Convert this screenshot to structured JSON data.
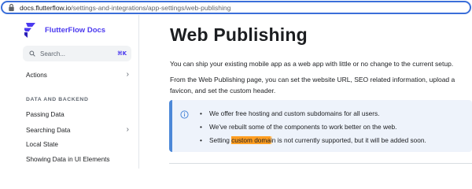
{
  "browser": {
    "url_host": "docs.flutterflow.io",
    "url_path": "/settings-and-integrations/app-settings/web-publishing"
  },
  "sidebar": {
    "brand": "FlutterFlow Docs",
    "search_placeholder": "Search...",
    "search_shortcut": "⌘K",
    "items": [
      {
        "label": "Actions",
        "has_chevron": true
      },
      {
        "label": "Passing Data",
        "has_chevron": false
      },
      {
        "label": "Searching Data",
        "has_chevron": true
      },
      {
        "label": "Local State",
        "has_chevron": false
      },
      {
        "label": "Showing Data in UI Elements",
        "has_chevron": false
      }
    ],
    "section_heading": "DATA AND BACKEND"
  },
  "main": {
    "title": "Web Publishing",
    "para1": "You can ship your existing mobile app as a web app with little or no change to the current setup.",
    "para2_line1": "From the Web Publishing page, you can set the website URL, SEO related information, upload a",
    "para2_line2": "favicon, and set the custom header.",
    "notes": [
      "We offer free hosting and custom subdomains for all users.",
      "We've rebuilt some of the components to work better on the web."
    ],
    "note3": {
      "before": "Setting ",
      "highlight_strong": "custom doma",
      "highlight_light": "i",
      "after": "n is not currently supported, but it will be added soon."
    }
  },
  "colors": {
    "brand": "#4b39ef",
    "url_focus": "#3b6fd9",
    "admonition_bg": "#eef3fb",
    "admonition_border": "#4c88d8",
    "highlight": "#ff9e22"
  },
  "icons": [
    "lock-icon",
    "flutterflow-logo",
    "search-icon",
    "chevron-right-icon",
    "info-icon"
  ]
}
